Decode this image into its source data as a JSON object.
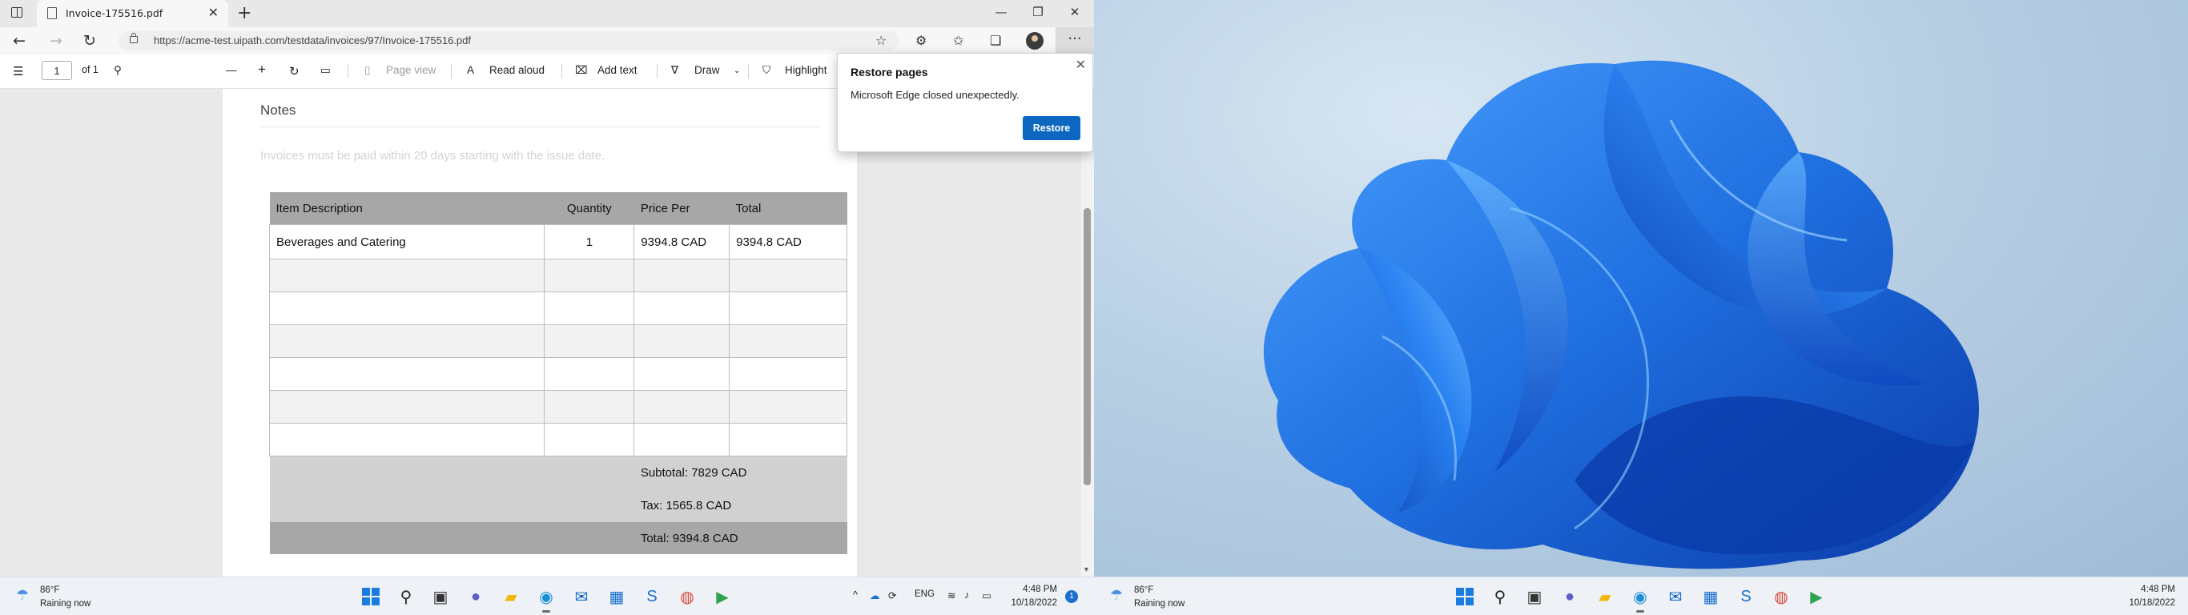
{
  "browser": {
    "tab_title": "Invoice-175516.pdf",
    "tab_close": "✕",
    "new_tab": "+",
    "url": "https://acme-test.uipath.com/testdata/invoices/97/Invoice-175516.pdf",
    "window_controls": {
      "minimize": "—",
      "restore": "❐",
      "close": "✕"
    },
    "more_label": "···"
  },
  "pdf_toolbar": {
    "page_current": "1",
    "page_total": "of 1",
    "zoom_out": "—",
    "zoom_in": "+",
    "page_view": "Page view",
    "read_aloud": "Read aloud",
    "add_text": "Add text",
    "draw": "Draw",
    "highlight": "Highlight"
  },
  "document": {
    "notes_title": "Notes",
    "notes_text": "Invoices must be paid within 20 days starting with the issue date.",
    "table_headers": [
      "Item Description",
      "Quantity",
      "Price Per",
      "Total"
    ],
    "rows": [
      {
        "description": "Beverages and Catering",
        "quantity": "1",
        "price": "9394.8 CAD",
        "total": "9394.8 CAD"
      }
    ],
    "subtotal": "Subtotal: 7829 CAD",
    "tax": "Tax: 1565.8 CAD",
    "total": "Total: 9394.8 CAD"
  },
  "restore_popup": {
    "title": "Restore pages",
    "message": "Microsoft Edge closed unexpectedly.",
    "button": "Restore",
    "close": "✕"
  },
  "taskbar_left": {
    "weather_temp": "86°F",
    "weather_desc": "Raining now",
    "tray_language": "ENG",
    "time": "4:48 PM",
    "date": "10/18/2022",
    "notification_count": "1"
  },
  "taskbar_right": {
    "weather_temp": "86°F",
    "weather_desc": "Raining now",
    "time": "4:48 PM",
    "date": "10/18/2022"
  },
  "colors": {
    "accent": "#0c67c1",
    "wallpaper_blue": "#1f6fe0",
    "taskbar": "#eef1f6"
  },
  "icons": [
    "windows-start-icon",
    "search-icon",
    "task-view-icon",
    "teams-chat-icon",
    "file-explorer-icon",
    "edge-icon",
    "mail-icon",
    "store-icon",
    "uipath-studio-icon",
    "chrome-icon",
    "uipath-assistant-icon"
  ]
}
